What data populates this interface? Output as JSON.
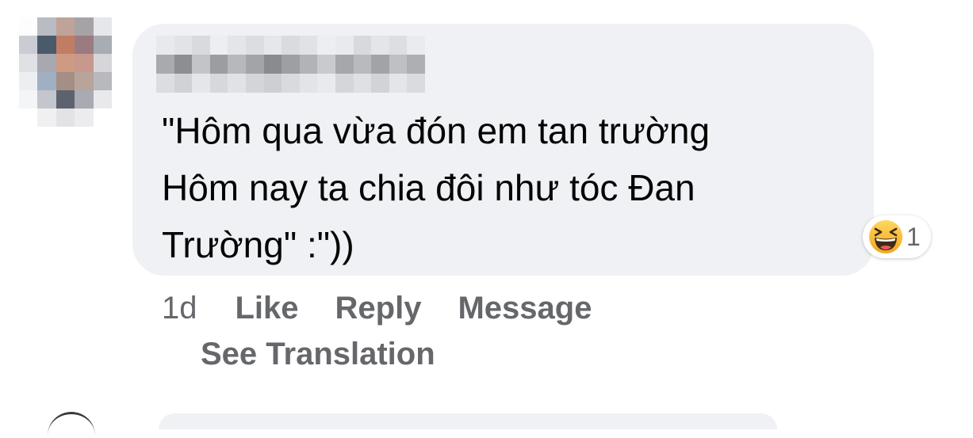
{
  "comment": {
    "text": "\"Hôm qua vừa đón em tan trường\nHôm nay ta chia đôi như tóc Đan\nTrường\" :\"))",
    "reaction": {
      "icon": "laughing-emoji-icon",
      "count": "1"
    },
    "actions": {
      "time": "1d",
      "like": "Like",
      "reply": "Reply",
      "message": "Message",
      "see_translation": "See Translation"
    }
  },
  "colors": {
    "bubble_bg": "#eff1f4",
    "text": "#050505",
    "secondary_text": "#65676b",
    "emoji_yellow": "#f7b125"
  }
}
